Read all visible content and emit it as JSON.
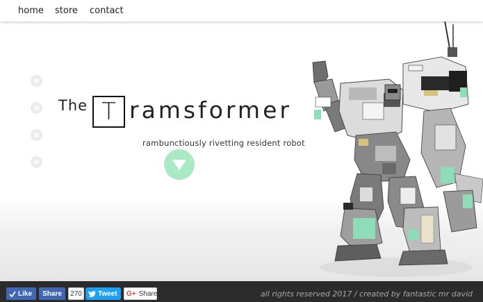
{
  "nav": {
    "items": [
      {
        "label": "home"
      },
      {
        "label": "store"
      },
      {
        "label": "contact"
      }
    ]
  },
  "hero": {
    "title_prefix": "The",
    "title_boxed_letter": "T",
    "title_rest": "ramsformer",
    "tagline": "rambunctiously rivetting resident robot",
    "scroll_icon": "chevron-down-icon",
    "accent_color": "#a9e9c4"
  },
  "footer": {
    "like_label": "Like",
    "share_label": "Share",
    "share_count": "270",
    "tweet_label": "Tweet",
    "gplus_icon": "G+",
    "gplus_share_label": "Share",
    "copyright": "all rights reserved 2017 / created by fantastic mr david",
    "colors": {
      "facebook": "#4267b2",
      "twitter": "#1da1f2",
      "footer_bg": "#2b2b2b"
    }
  }
}
